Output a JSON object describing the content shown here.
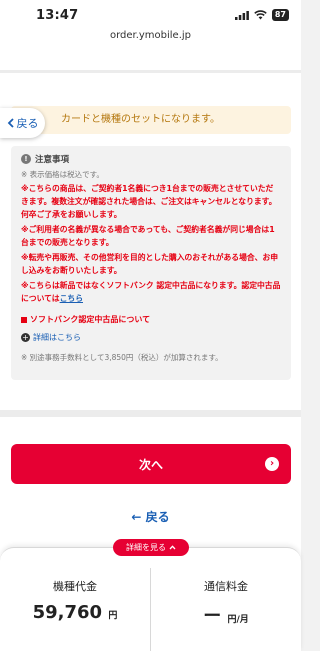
{
  "status_bar": {
    "time": "13:47",
    "battery": "87"
  },
  "url": "order.ymobile.jp",
  "info_bar": {
    "text": "カードと機種のセットになります。"
  },
  "back_chip": {
    "label": "戻る"
  },
  "notes": {
    "title": "注意事項",
    "tax_note": "※ 表示価格は税込です。",
    "red_1": "※こちらの商品は、ご契約者1名義につき1台までの販売とさせていただきます。複数注文が確認された場合は、ご注文はキャンセルとなります。何卒ご了承をお願いします。",
    "red_2": "※ご利用者の名義が異なる場合であっても、ご契約者名義が同じ場合は1台までの販売となります。",
    "red_3": "※転売や再販売、その他営利を目的とした購入のおそれがある場合、お申し込みをお断りいたします。",
    "red_4_text": "※こちらは新品ではなくソフトバンク 認定中古品になります。認定中古品については",
    "red_4_link": "こちら",
    "section_head": "ソフトバンク認定中古品について",
    "detail_link": "詳細はこちら",
    "fee_note": "※ 別途事務手数料として3,850円（税込）が加算されます。"
  },
  "next_button": {
    "label": "次へ"
  },
  "back_link": {
    "label": "戻る"
  },
  "summary": {
    "detail_pill": "詳細を見る",
    "device_label": "機種代金",
    "device_value": "59,760",
    "device_unit": "円",
    "plan_label": "通信料金",
    "plan_value": "ー",
    "plan_unit": "円/月"
  },
  "colors": {
    "brand_red": "#e60033",
    "link_blue": "#1a5fb4",
    "warning_text": "#e60012"
  }
}
